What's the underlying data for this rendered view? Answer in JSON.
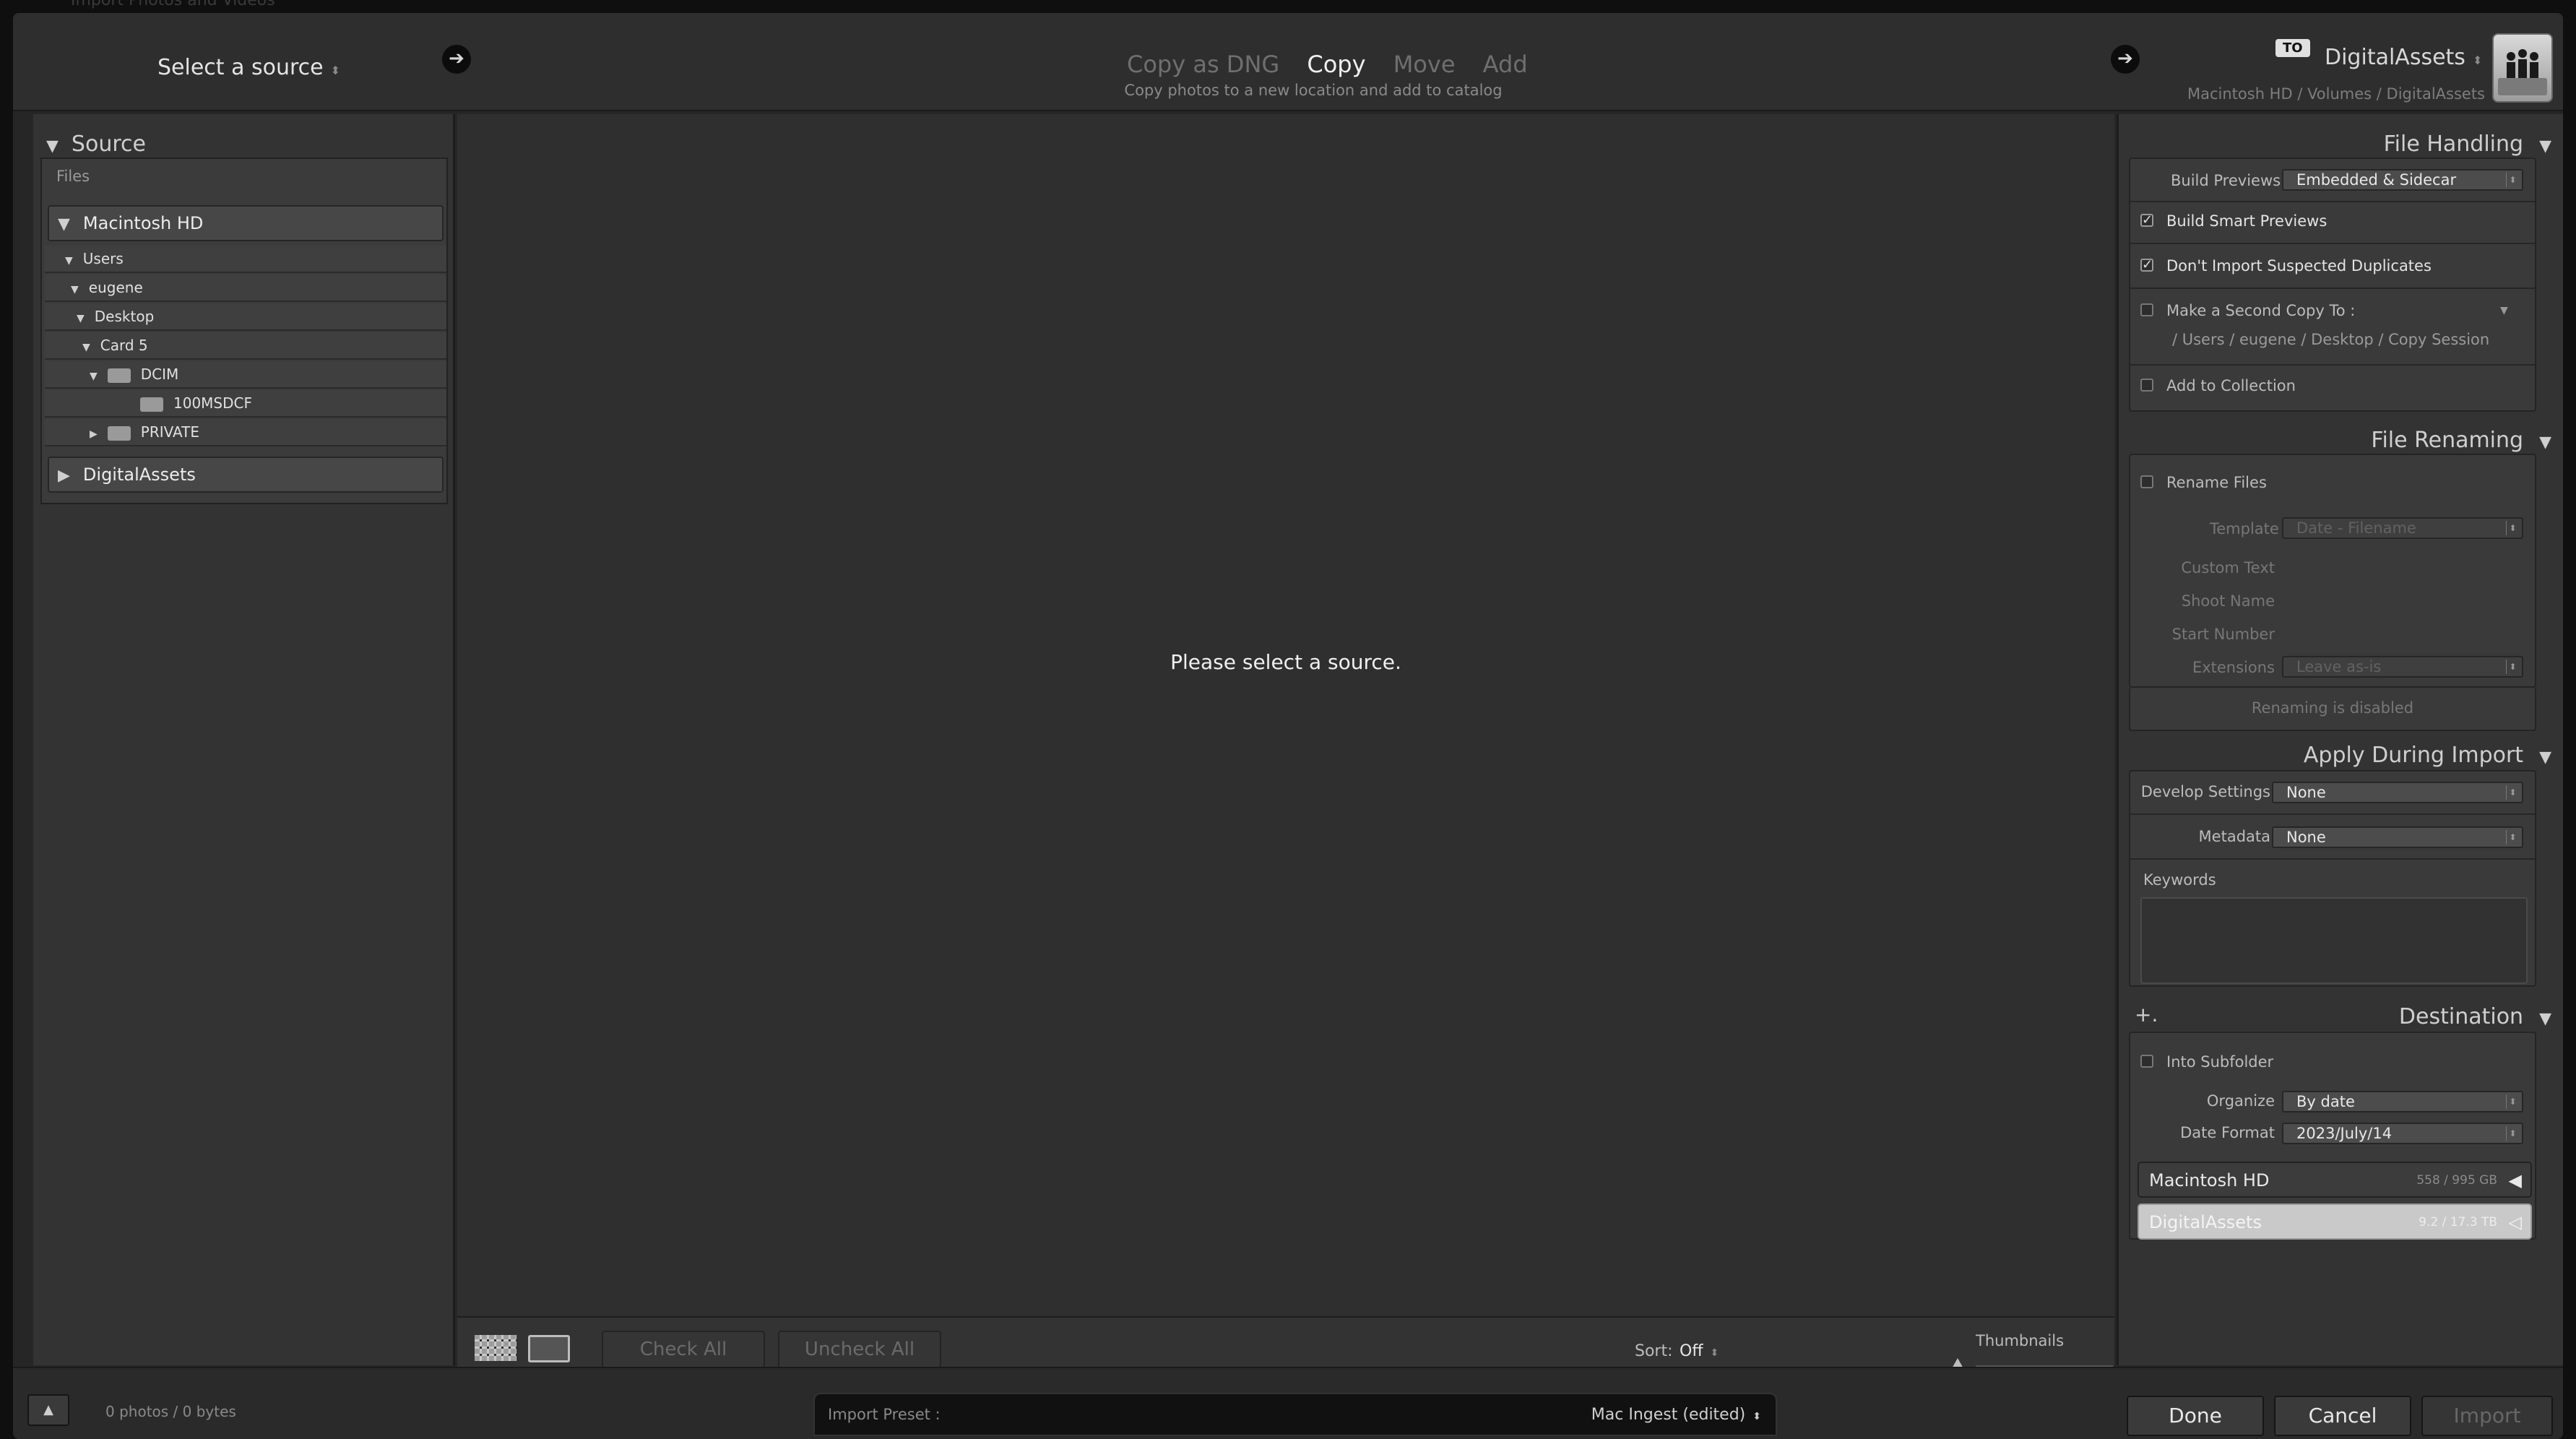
{
  "window": {
    "title": "Import Photos and Videos"
  },
  "topbar": {
    "source_label": "Select a source",
    "updown_glyph": "⬍",
    "arrow_glyph": "➔",
    "modes": [
      {
        "label": "Copy as DNG",
        "active": false
      },
      {
        "label": "Copy",
        "active": true
      },
      {
        "label": "Move",
        "active": false
      },
      {
        "label": "Add",
        "active": false
      }
    ],
    "mode_subtitle": "Copy photos to a new location and add to catalog",
    "to_badge": "TO",
    "destination_name": "DigitalAssets",
    "destination_path": "Macintosh HD / Volumes / DigitalAssets"
  },
  "source": {
    "title": "Source",
    "files_label": "Files",
    "volumes": [
      {
        "name": "Macintosh HD",
        "expanded": true
      },
      {
        "name": "DigitalAssets",
        "expanded": false
      }
    ],
    "tree": [
      {
        "label": "Users",
        "depth": 0,
        "expanded": true,
        "folder_icon": false
      },
      {
        "label": "eugene",
        "depth": 1,
        "expanded": true,
        "folder_icon": false
      },
      {
        "label": "Desktop",
        "depth": 2,
        "expanded": true,
        "folder_icon": false
      },
      {
        "label": "Card 5",
        "depth": 3,
        "expanded": true,
        "folder_icon": false
      },
      {
        "label": "DCIM",
        "depth": 4,
        "expanded": true,
        "folder_icon": true
      },
      {
        "label": "100MSDCF",
        "depth": 5,
        "expanded": false,
        "folder_icon": true
      },
      {
        "label": "PRIVATE",
        "depth": 4,
        "expanded": false,
        "folder_icon": true
      }
    ]
  },
  "center": {
    "message": "Please select a source.",
    "check_all": "Check All",
    "uncheck_all": "Uncheck All",
    "sort_label": "Sort:",
    "sort_value": "Off",
    "thumbnails_label": "Thumbnails"
  },
  "file_handling": {
    "title": "File Handling",
    "build_previews_label": "Build Previews",
    "build_previews_value": "Embedded & Sidecar",
    "build_smart_previews": "Build Smart Previews",
    "dont_import_duplicates": "Don't Import Suspected Duplicates",
    "second_copy_label": "Make a Second Copy To :",
    "second_copy_path": "/ Users / eugene / Desktop / Copy Session",
    "add_to_collection": "Add to Collection",
    "check_glyph": "✓"
  },
  "file_renaming": {
    "title": "File Renaming",
    "rename_files": "Rename Files",
    "template_label": "Template",
    "template_value": "Date - Filename",
    "custom_text": "Custom Text",
    "shoot_name": "Shoot Name",
    "start_number": "Start Number",
    "extensions_label": "Extensions",
    "extensions_value": "Leave as-is",
    "disabled_note": "Renaming is disabled"
  },
  "apply_during_import": {
    "title": "Apply During Import",
    "develop_label": "Develop Settings",
    "develop_value": "None",
    "metadata_label": "Metadata",
    "metadata_value": "None",
    "keywords_label": "Keywords"
  },
  "destination": {
    "title": "Destination",
    "plus": "+.",
    "into_subfolder": "Into Subfolder",
    "organize_label": "Organize",
    "organize_value": "By date",
    "date_format_label": "Date Format",
    "date_format_value": "2023/July/14",
    "drives": [
      {
        "name": "Macintosh HD",
        "capacity": "558 / 995 GB",
        "selected": false
      },
      {
        "name": "DigitalAssets",
        "capacity": "9.2 / 17.3 TB",
        "selected": true
      }
    ]
  },
  "footer": {
    "up_glyph": "▲",
    "count": "0 photos / 0 bytes",
    "preset_label": "Import Preset :",
    "preset_value": "Mac Ingest (edited)",
    "done": "Done",
    "cancel": "Cancel",
    "import": "Import"
  },
  "colors": {
    "window_bg": "#262626",
    "panel_bg": "#333333",
    "center_bg": "#2f2f2f",
    "selected_drive_bg": "#c9c9c9"
  }
}
